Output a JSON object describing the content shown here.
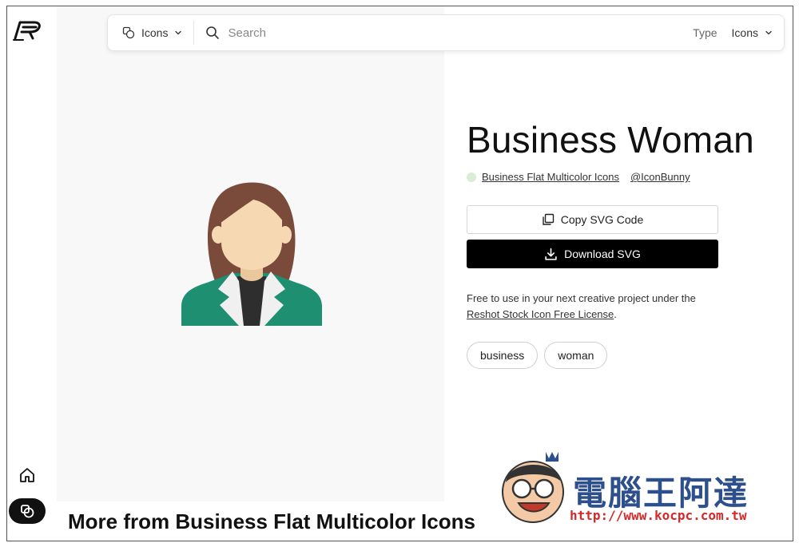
{
  "search": {
    "type_label": "Icons",
    "placeholder": "Search",
    "filter_label": "Type",
    "filter_value": "Icons"
  },
  "icon": {
    "title": "Business Woman",
    "collection": "Business Flat Multicolor Icons",
    "author": "@IconBunny"
  },
  "actions": {
    "copy_label": "Copy SVG Code",
    "download_label": "Download SVG"
  },
  "license": {
    "text": "Free to use in your next creative project under the",
    "link": "Reshot Stock Icon Free License",
    "suffix": "."
  },
  "tags": [
    "business",
    "woman"
  ],
  "more_heading": "More from Business Flat Multicolor Icons",
  "watermark": {
    "title": "電腦王阿達",
    "url": "http://www.kocpc.com.tw"
  },
  "colors": {
    "hair": "#7a4b3a",
    "skin": "#f6d9b3",
    "jacket": "#1f8f72",
    "collar": "#f0f0f0",
    "shirt": "#2e2e2e",
    "collection_dot": "#d9ecd4",
    "watermark_blue": "#2d4f8c",
    "watermark_red": "#d62828"
  },
  "icons": {
    "logo": "reshot-logo-icon",
    "type_select": "shapes-icon",
    "chevron": "chevron-down-icon",
    "search": "search-icon",
    "copy": "copy-icon",
    "download": "download-icon",
    "home": "home-icon",
    "collections": "collections-icon"
  }
}
